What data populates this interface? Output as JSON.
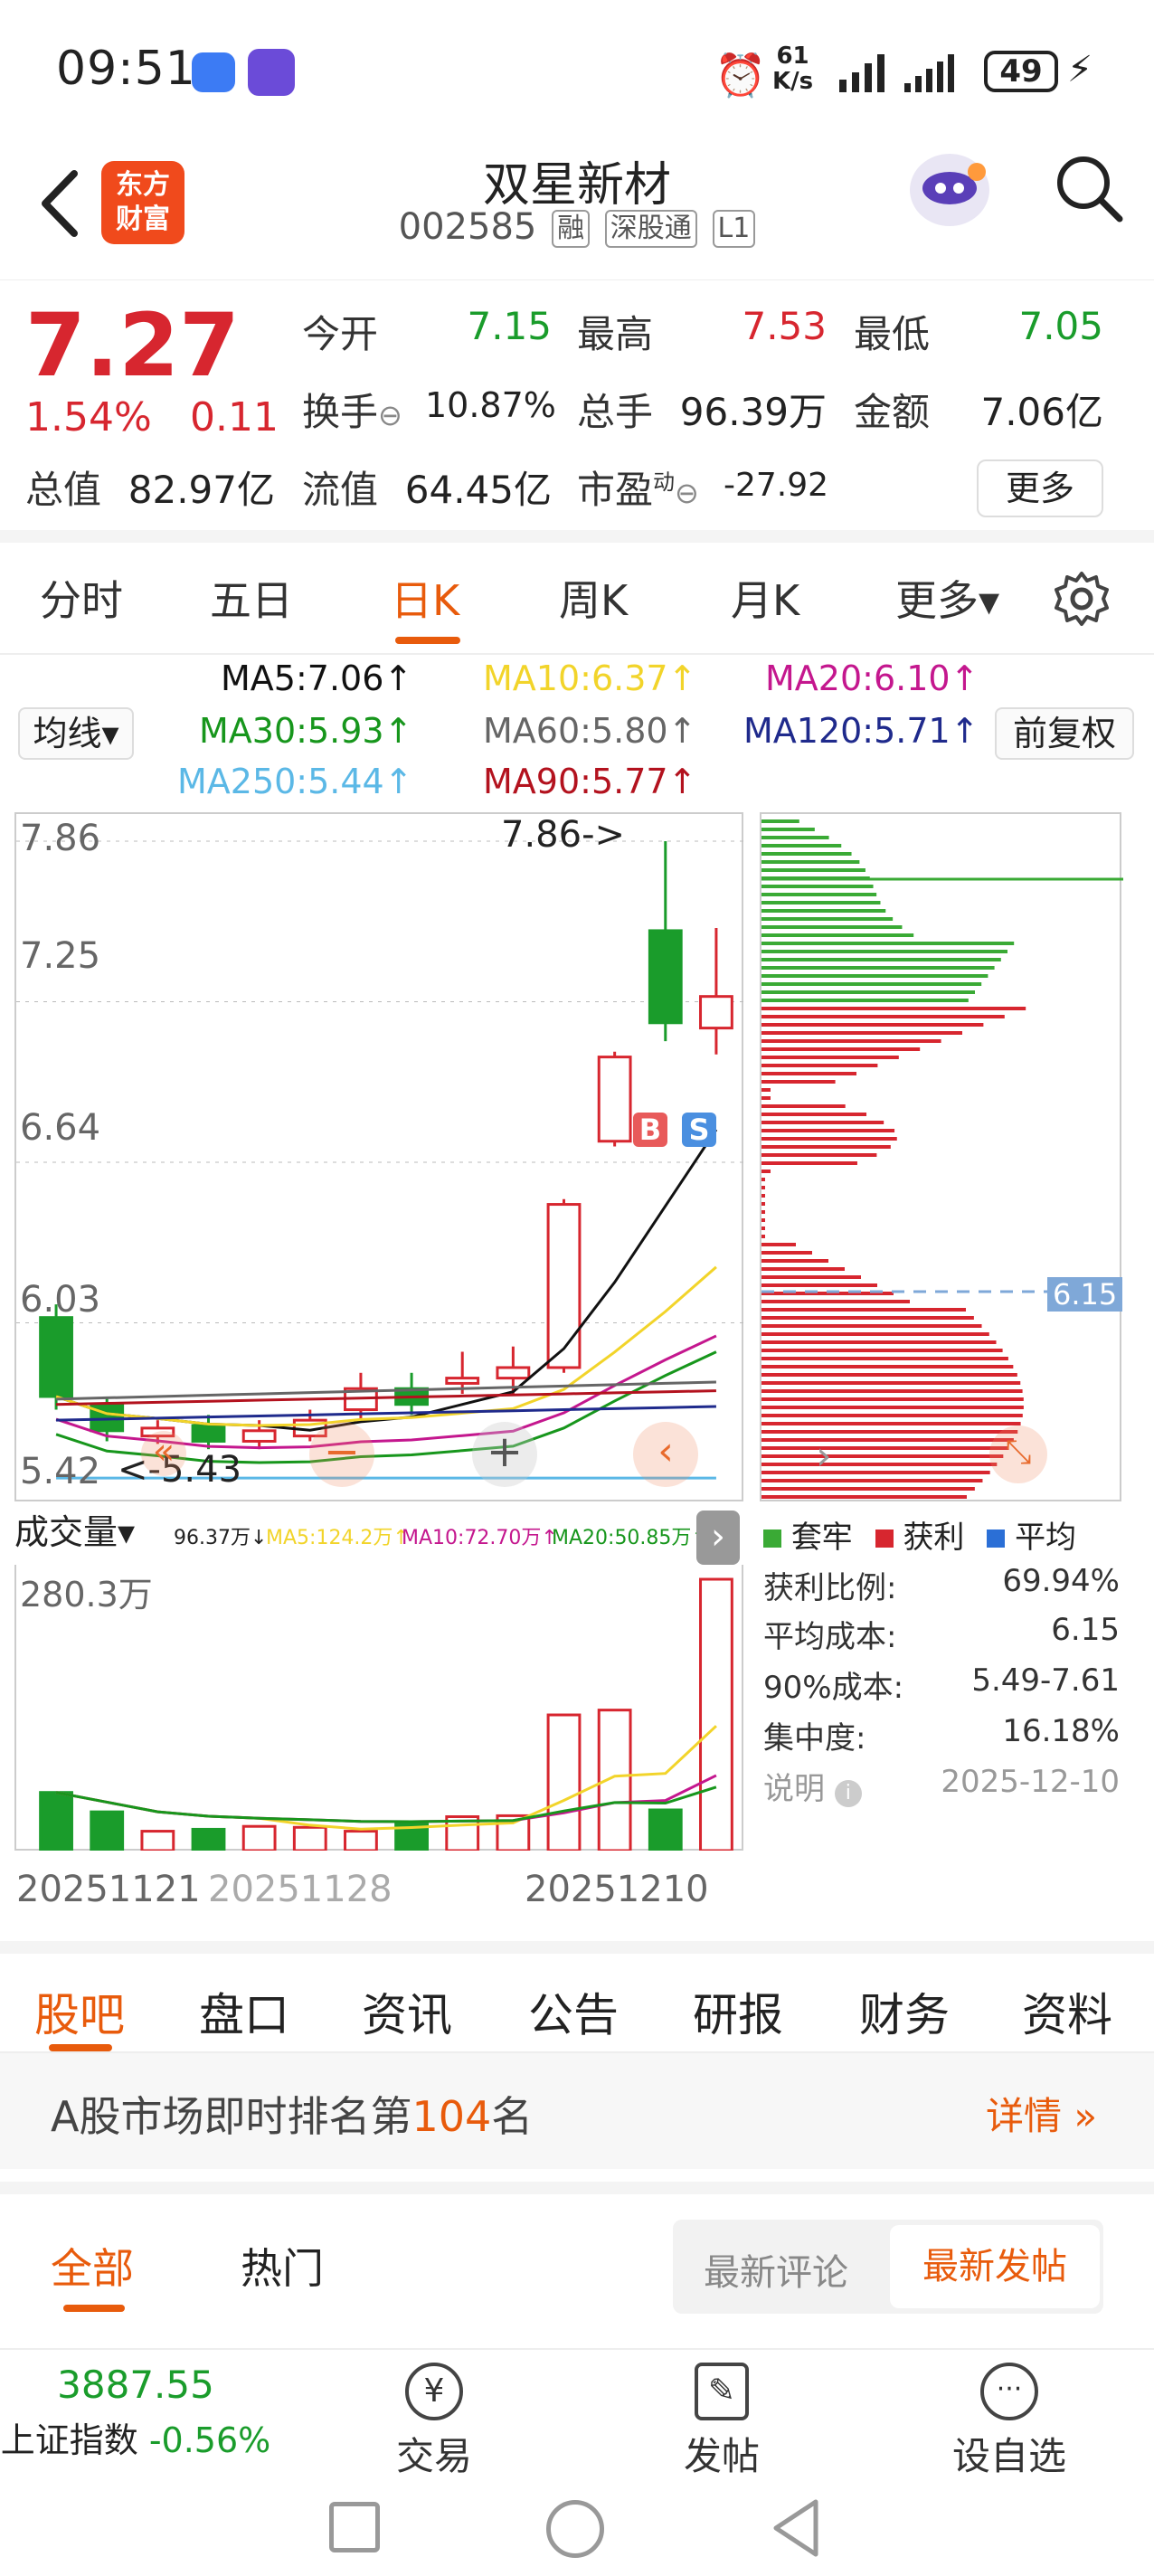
{
  "status": {
    "time": "09:51",
    "net_speed_top": "61",
    "net_speed_unit": "K/s",
    "battery": "49"
  },
  "header": {
    "logo_line1": "东方",
    "logo_line2": "财富",
    "stock_name": "双星新材",
    "stock_code": "002585",
    "tags": [
      "融",
      "深股通",
      "L1"
    ]
  },
  "quote": {
    "price": "7.27",
    "change_pct": "1.54%",
    "change": "0.11",
    "fields": {
      "open_label": "今开",
      "open": "7.15",
      "high_label": "最高",
      "high": "7.53",
      "low_label": "最低",
      "low": "7.05",
      "turnover_label": "换手",
      "turnover": "10.87%",
      "volume_label": "总手",
      "volume": "96.39万",
      "amount_label": "金额",
      "amount": "7.06亿",
      "mktcap_label": "总值",
      "mktcap": "82.97亿",
      "float_label": "流值",
      "float": "64.45亿",
      "pe_label": "市盈",
      "pe_sup": "动",
      "pe": "-27.92"
    },
    "more_button": "更多"
  },
  "period_tabs": [
    "分时",
    "五日",
    "日K",
    "周K",
    "月K",
    "更多▾"
  ],
  "active_period": "日K",
  "ma_legend": {
    "ma5": "MA5:7.06↑",
    "ma10": "MA10:6.37↑",
    "ma20": "MA20:6.10↑",
    "ma30": "MA30:5.93↑",
    "ma60": "MA60:5.80↑",
    "ma120": "MA120:5.71↑",
    "ma250": "MA250:5.44↑",
    "ma90": "MA90:5.77↑",
    "indicator_select": "均线▾",
    "adjust_button": "前复权"
  },
  "colors": {
    "up": "#d7262f",
    "down": "#1a9c2b",
    "ma5": "#111111",
    "ma10": "#f2d42a",
    "ma20": "#c4178e",
    "ma30": "#17961c",
    "ma60": "#666666",
    "ma120": "#1f2a8c",
    "ma250": "#5bb8e6",
    "ma90": "#b3121e",
    "accent": "#e85b0c"
  },
  "price_axis": [
    "7.86",
    "7.25",
    "6.64",
    "6.03",
    "5.42"
  ],
  "annotations": {
    "high_mark": "7.86->",
    "low_mark": "<-5.43",
    "buy": "B",
    "sell": "S",
    "cost_tag": "6.15"
  },
  "volume_header": {
    "select": "成交量▾",
    "vol": "96.37万↓",
    "ma5": "MA5:124.2万↑",
    "ma10": "MA10:72.70万↑",
    "ma20": "MA20:50.85万↑",
    "axis_max": "280.3万"
  },
  "date_axis": [
    "20251121",
    "20251128",
    "20251210"
  ],
  "chart_data": {
    "type": "candlestick",
    "ylim": [
      5.42,
      7.86
    ],
    "candles": [
      {
        "o": 6.05,
        "c": 5.75,
        "h": 6.1,
        "l": 5.7,
        "v": 60
      },
      {
        "o": 5.72,
        "c": 5.62,
        "h": 5.75,
        "l": 5.58,
        "v": 40
      },
      {
        "o": 5.6,
        "c": 5.63,
        "h": 5.66,
        "l": 5.57,
        "v": 20
      },
      {
        "o": 5.64,
        "c": 5.58,
        "h": 5.68,
        "l": 5.55,
        "v": 22
      },
      {
        "o": 5.58,
        "c": 5.62,
        "h": 5.66,
        "l": 5.55,
        "v": 25
      },
      {
        "o": 5.6,
        "c": 5.66,
        "h": 5.7,
        "l": 5.58,
        "v": 24
      },
      {
        "o": 5.7,
        "c": 5.78,
        "h": 5.84,
        "l": 5.66,
        "v": 20
      },
      {
        "o": 5.78,
        "c": 5.72,
        "h": 5.84,
        "l": 5.68,
        "v": 28
      },
      {
        "o": 5.8,
        "c": 5.82,
        "h": 5.92,
        "l": 5.76,
        "v": 35
      },
      {
        "o": 5.82,
        "c": 5.86,
        "h": 5.94,
        "l": 5.76,
        "v": 36
      },
      {
        "o": 5.86,
        "c": 6.48,
        "h": 6.5,
        "l": 5.84,
        "v": 140
      },
      {
        "o": 6.72,
        "c": 7.04,
        "h": 7.06,
        "l": 6.7,
        "v": 145
      },
      {
        "o": 7.52,
        "c": 7.17,
        "h": 7.86,
        "l": 7.1,
        "v": 42
      },
      {
        "o": 7.15,
        "c": 7.27,
        "h": 7.53,
        "l": 7.05,
        "v": 280
      }
    ],
    "volume_unit": "万"
  },
  "profile": {
    "legend": [
      "套牢",
      "获利",
      "平均"
    ],
    "stats": [
      {
        "label": "获利比例:",
        "value": "69.94%"
      },
      {
        "label": "平均成本:",
        "value": "6.15"
      },
      {
        "label": "90%成本:",
        "value": "5.49-7.61"
      },
      {
        "label": "集中度:",
        "value": "16.18%"
      },
      {
        "label": "说明",
        "value": "2025-12-10"
      }
    ]
  },
  "sub_tabs": [
    "股吧",
    "盘口",
    "资讯",
    "公告",
    "研报",
    "财务",
    "资料"
  ],
  "rank": {
    "prefix": "A股市场即时排名第",
    "num": "104",
    "suffix": "名",
    "detail": "详情 »"
  },
  "post_filter": {
    "all": "全部",
    "hot": "热门",
    "latest_comment": "最新评论",
    "latest_post": "最新发帖"
  },
  "bottom": {
    "index_value": "3887.55",
    "index_name": "上证指数",
    "index_change": "-0.56%",
    "trade": "交易",
    "post": "发帖",
    "watch": "设自选"
  }
}
